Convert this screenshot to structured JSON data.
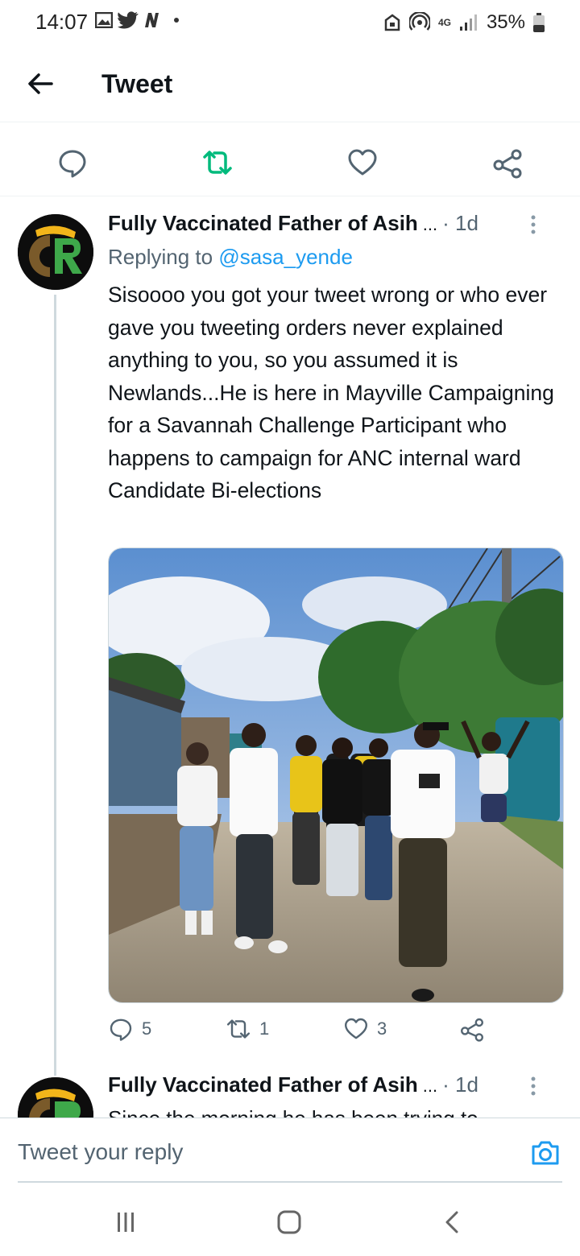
{
  "status_bar": {
    "time": "14:07",
    "network": "4G",
    "battery": "35%"
  },
  "header": {
    "title": "Tweet",
    "back_icon": "arrow-left-icon"
  },
  "main_tweet_actions": {
    "icons": [
      "reply-icon",
      "retweet-icon",
      "like-icon",
      "share-icon"
    ],
    "retweeted_color": "#00ba7c"
  },
  "reply_tweet": {
    "author_name": "Fully Vaccinated Father of Asih",
    "truncation": "...",
    "time": "· 1d",
    "replying_prefix": "Replying to",
    "replying_handle": "@sasa_yende",
    "body": "Sisoooo you got your tweet wrong or who ever gave you tweeting orders never explained anything to you, so you assumed it is Newlands...He is here in Mayville Campaigning for a Savannah Challenge Participant who happens to campaign for ANC internal ward Candidate Bi-elections",
    "counts": {
      "replies": "5",
      "retweets": "1",
      "likes": "3"
    }
  },
  "next_reply": {
    "author_name": "Fully Vaccinated Father of Asih",
    "truncation": "...",
    "time": "· 1d",
    "preview": "Since the morning he has been trying to"
  },
  "compose": {
    "placeholder": "Tweet your reply"
  },
  "colors": {
    "accent": "#1d9bf0",
    "secondary_text": "#536471",
    "divider": "#eff3f4"
  }
}
